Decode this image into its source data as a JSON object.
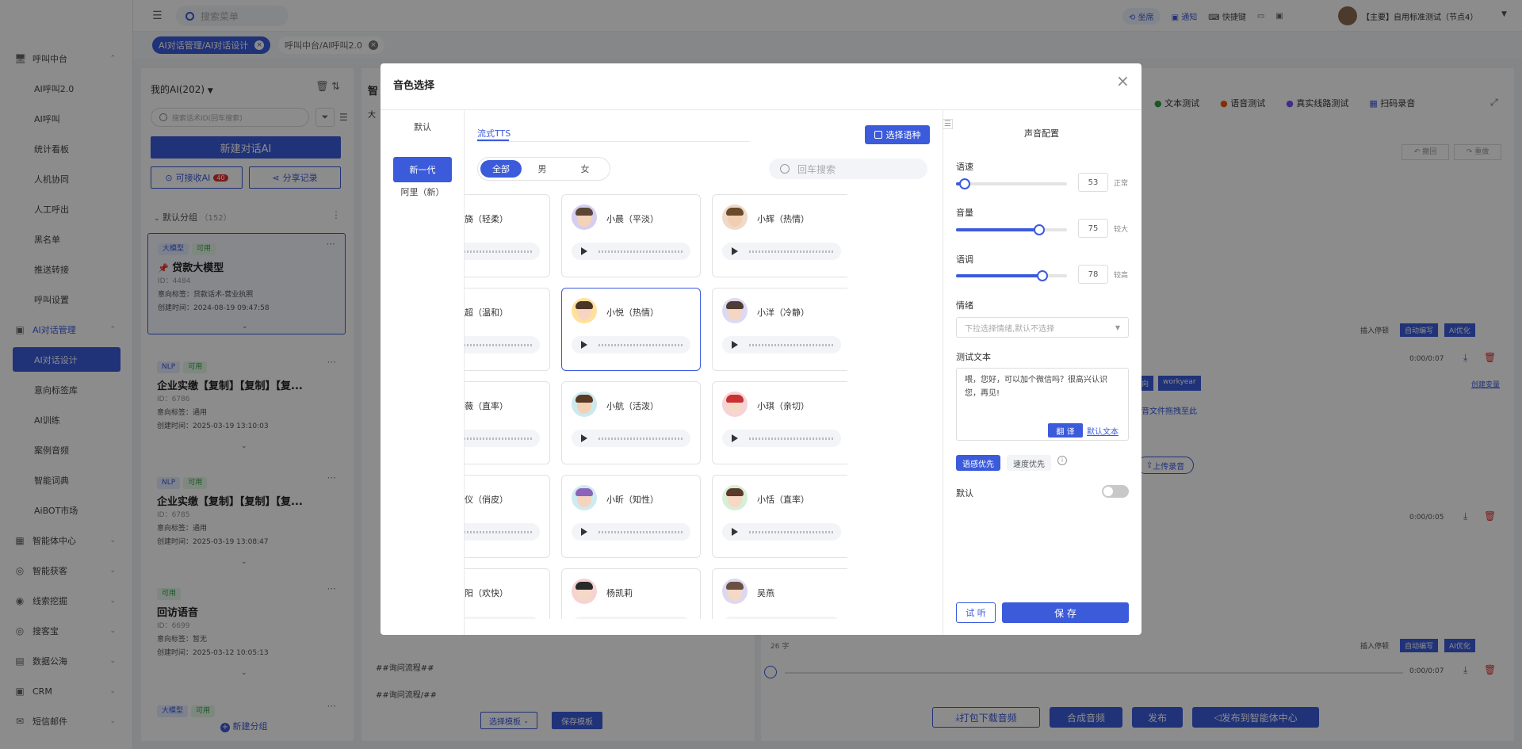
{
  "header": {
    "search_placeholder": "搜索菜单",
    "links": [
      "坐席",
      "通知",
      "快捷键"
    ],
    "user": "【主要】自用标准测试（节点4）"
  },
  "tabs": [
    {
      "label": "AI对话管理/AI对话设计"
    },
    {
      "label": "呼叫中台/AI呼叫2.0"
    }
  ],
  "sidebar": {
    "groups": [
      {
        "label": "呼叫中台",
        "items": [
          "AI呼叫2.0",
          "AI呼叫",
          "统计看板",
          "人机协同",
          "人工呼出",
          "黑名单",
          "推送转接",
          "呼叫设置"
        ]
      },
      {
        "label": "AI对话管理",
        "items": [
          "AI对话设计",
          "意向标签库",
          "AI训练",
          "案例音频",
          "智能词典",
          "AiBOT市场"
        ]
      }
    ],
    "more": [
      "智能体中心",
      "智能获客",
      "线索挖掘",
      "搜客宝",
      "数据公海",
      "CRM",
      "短信邮件"
    ]
  },
  "left_panel": {
    "title": "我的AI(202)",
    "search_placeholder": "搜索话术ID(回车搜索)",
    "new_button": "新建对话AI",
    "receive_button": "可接收AI",
    "receive_badge": "40",
    "share_button": "分享记录",
    "group_label": "默认分组",
    "group_count": "（152）",
    "new_group": "新建分组",
    "cards": [
      {
        "tags": [
          "大模型",
          "可用"
        ],
        "title": "贷款大模型",
        "id": "ID：4484",
        "intent": "意向标签：贷款话术-营业执照",
        "created": "创建时间：2024-08-19 09:47:58"
      },
      {
        "tags": [
          "NLP",
          "可用"
        ],
        "title": "企业实缴【复制】【复制】【复...",
        "id": "ID：6786",
        "intent": "意向标签：通用",
        "created": "创建时间：2025-03-19 13:10:03"
      },
      {
        "tags": [
          "NLP",
          "可用"
        ],
        "title": "企业实缴【复制】【复制】【复...",
        "id": "ID：6785",
        "intent": "意向标签：通用",
        "created": "创建时间：2025-03-19 13:08:47"
      },
      {
        "tags": [
          "可用"
        ],
        "title": "回访语音",
        "id": "ID：6699",
        "intent": "意向标签：暂无",
        "created": "创建时间：2025-03-12 10:05:13"
      },
      {
        "tags": [
          "大模型",
          "可用"
        ],
        "title": "",
        "id": "",
        "intent": "",
        "created": ""
      }
    ]
  },
  "middle": {
    "title_partial": "智",
    "sub_partial": "大",
    "flow1": "##询问流程##",
    "flow2": "##询问流程/##",
    "template_select": "选择模板",
    "template_save": "保存模板"
  },
  "right": {
    "tests": [
      "文本测试",
      "语音测试",
      "真实线路测试",
      "扫码录音"
    ],
    "undo": "撤回",
    "redo": "重做",
    "insert_pause": "插入停顿",
    "auto_write": "自动编写",
    "ai_optimize": "AI优化",
    "time1": "0:00/0:07",
    "time2": "0:00/0:05",
    "time3": "0:00/0:07",
    "upload_hint": "音文件拖拽至此",
    "upload_btn": "上传录音",
    "tag_partial": "向",
    "tag_workyear": "workyear",
    "create_var": "创建变量",
    "char_count": "26 字"
  },
  "bottom": {
    "download": "打包下载音频",
    "synth": "合成音频",
    "publish": "发布",
    "publish_center": "发布到智能体中心"
  },
  "modal": {
    "title": "音色选择",
    "categories": [
      "默认",
      "新一代",
      "阿里（新）"
    ],
    "active_category": "新一代",
    "stream_tab": "流式TTS",
    "choose_lang": "选择语种",
    "genders": [
      "全部",
      "男",
      "女"
    ],
    "search_placeholder": "回车搜索",
    "voices": [
      {
        "name": "小旖（轻柔）",
        "bg": "#d7dbe8",
        "hair": "#2a2a3a",
        "skin": "#f6d8c2"
      },
      {
        "name": "小晨（平淡）",
        "bg": "#d6cdef",
        "hair": "#5b4636",
        "skin": "#f3d2b6"
      },
      {
        "name": "小辉（热情）",
        "bg": "#efd9c8",
        "hair": "#6a4a2a",
        "skin": "#f0cfb0"
      },
      {
        "name": "小超（温和）",
        "bg": "#cde9d4",
        "hair": "#3a2f2a",
        "skin": "#f4d4bb"
      },
      {
        "name": "小悦（热情）",
        "bg": "#ffe19a",
        "hair": "#4a3428",
        "skin": "#f6d6c0"
      },
      {
        "name": "小洋（冷静）",
        "bg": "#dcd9f2",
        "hair": "#4d3d34",
        "skin": "#f4d6c2"
      },
      {
        "name": "小薇（直率）",
        "bg": "#f3cfcf",
        "hair": "#6b3a2a",
        "skin": "#f6d7c4"
      },
      {
        "name": "小航（活泼）",
        "bg": "#cde9ef",
        "hair": "#5a3a22",
        "skin": "#f2d0b4"
      },
      {
        "name": "小琪（亲切）",
        "bg": "#f7d2d6",
        "hair": "#c83232",
        "skin": "#f6d8c6"
      },
      {
        "name": "小仪（俏皮）",
        "bg": "#d9dcef",
        "hair": "#2d2a3a",
        "skin": "#f5d6c4"
      },
      {
        "name": "小昕（知性）",
        "bg": "#cfeaf0",
        "hair": "#8a64b8",
        "skin": "#f4d4c0"
      },
      {
        "name": "小恬（直率）",
        "bg": "#d6efd6",
        "hair": "#5a3a2a",
        "skin": "#f6d8c4"
      },
      {
        "name": "小阳（欢快）",
        "bg": "#cdebd6",
        "hair": "#3a2f2a",
        "skin": "#f4d4bb"
      },
      {
        "name": "杨凯莉",
        "bg": "#f6d2d2",
        "hair": "#2a2a2a",
        "skin": "#f6d8c6"
      },
      {
        "name": "吴燕",
        "bg": "#dcd8f0",
        "hair": "#6a5040",
        "skin": "#f6d8c6"
      }
    ],
    "selected_voice": "小悦（热情）",
    "config": {
      "title": "声音配置",
      "speed_label": "语速",
      "speed": 53,
      "speed_desc": "正常",
      "volume_label": "音量",
      "volume": 75,
      "volume_desc": "较大",
      "pitch_label": "语调",
      "pitch": 78,
      "pitch_desc": "较高",
      "emotion_label": "情绪",
      "emotion_placeholder": "下拉选择情绪,默认不选择",
      "test_label": "测试文本",
      "test_text": "喂，您好，可以加个微信吗？很高兴认识您，再见!",
      "translate_btn": "翻 译",
      "default_text_link": "默认文本",
      "quality_first": "语感优先",
      "speed_first": "速度优先",
      "default_label": "默认",
      "listen_btn": "试 听",
      "save_btn": "保 存"
    }
  }
}
